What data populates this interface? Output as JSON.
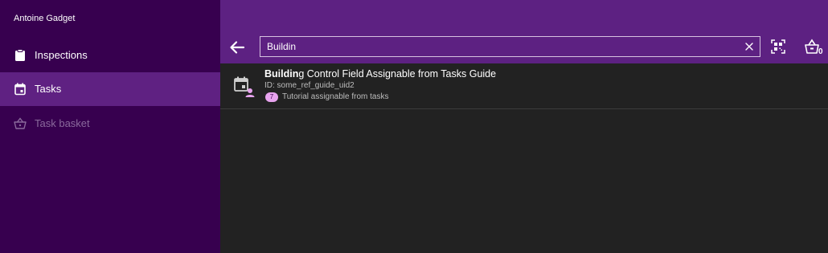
{
  "sidebar": {
    "user_name": "Antoine Gadget",
    "items": [
      {
        "label": "Inspections",
        "icon": "clipboard-icon",
        "active": false,
        "disabled": false
      },
      {
        "label": "Tasks",
        "icon": "calendar-icon",
        "active": true,
        "disabled": false
      },
      {
        "label": "Task basket",
        "icon": "basket-icon",
        "active": false,
        "disabled": true
      }
    ]
  },
  "header": {
    "search": {
      "value": "Buildin",
      "placeholder": ""
    },
    "basket_count": "0"
  },
  "results": [
    {
      "title_match": "Buildin",
      "title_rest": "g Control Field Assignable from Tasks Guide",
      "id_text": "ID: some_ref_guide_uid2",
      "badge": "7",
      "subtitle": "Tutorial assignable from tasks"
    }
  ],
  "colors": {
    "sidebar_bg": "#37004f",
    "header_bg": "#5d2182",
    "active_item_bg": "#5f2182",
    "content_bg": "#222222",
    "badge_bg": "#e7a3ee"
  }
}
